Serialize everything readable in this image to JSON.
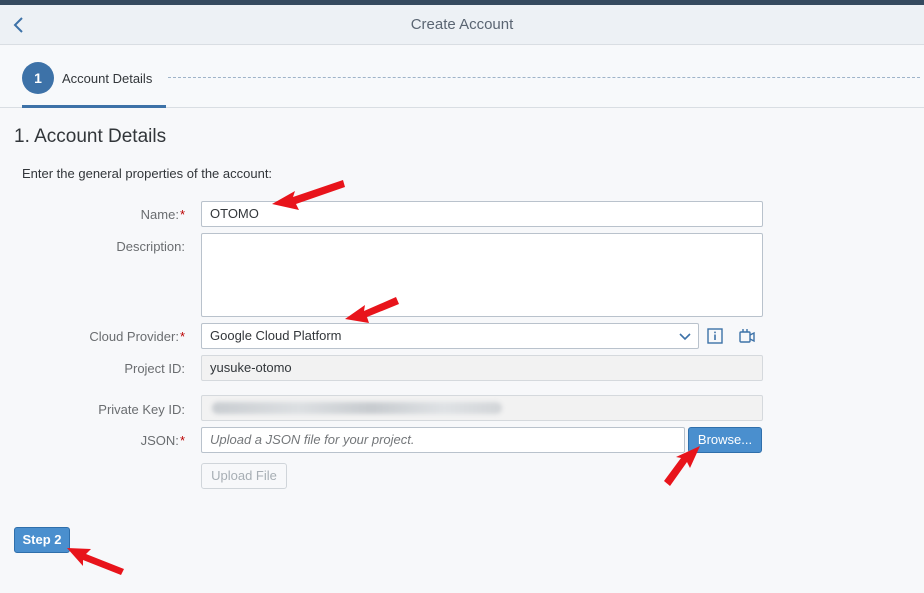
{
  "header": {
    "title": "Create Account"
  },
  "wizard": {
    "step_number": "1",
    "step_label": "Account Details"
  },
  "section": {
    "title": "1. Account Details",
    "intro": "Enter the general properties of the account:"
  },
  "form": {
    "name_label": "Name:",
    "name_value": "OTOMO",
    "description_label": "Description:",
    "description_value": "",
    "provider_label": "Cloud Provider:",
    "provider_value": "Google Cloud Platform",
    "project_label": "Project ID:",
    "project_value": "yusuke-otomo",
    "key_label": "Private Key ID:",
    "json_label": "JSON:",
    "json_placeholder": "Upload a JSON file for your project.",
    "browse_label": "Browse...",
    "upload_label": "Upload File",
    "required_mark": "*"
  },
  "footer": {
    "step2_label": "Step 2"
  },
  "colors": {
    "accent": "#3d72a8",
    "button": "#4a8fce",
    "required": "#bb0000",
    "arrow": "#e8141b"
  }
}
